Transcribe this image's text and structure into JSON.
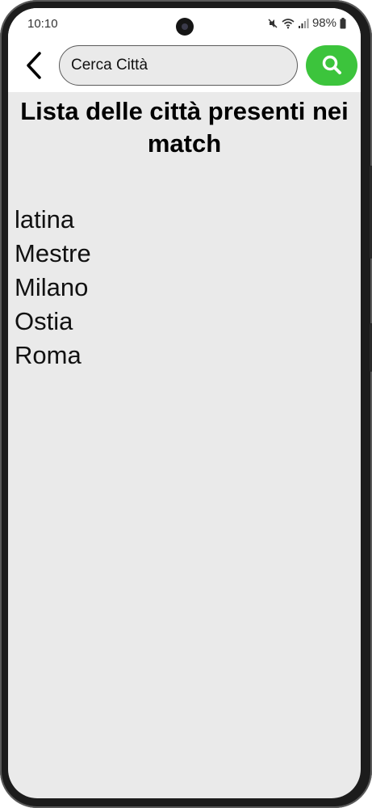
{
  "status_bar": {
    "time": "10:10",
    "battery": "98%"
  },
  "header": {
    "back_icon": "chevron-left-icon",
    "search": {
      "placeholder": "Cerca Città",
      "value": "Cerca Città"
    },
    "search_button_icon": "search-icon",
    "search_button_color": "#3cc43c"
  },
  "main": {
    "title": "Lista delle città presenti nei match",
    "cities": [
      "latina",
      "Mestre",
      "Milano",
      "Ostia",
      "Roma"
    ]
  }
}
